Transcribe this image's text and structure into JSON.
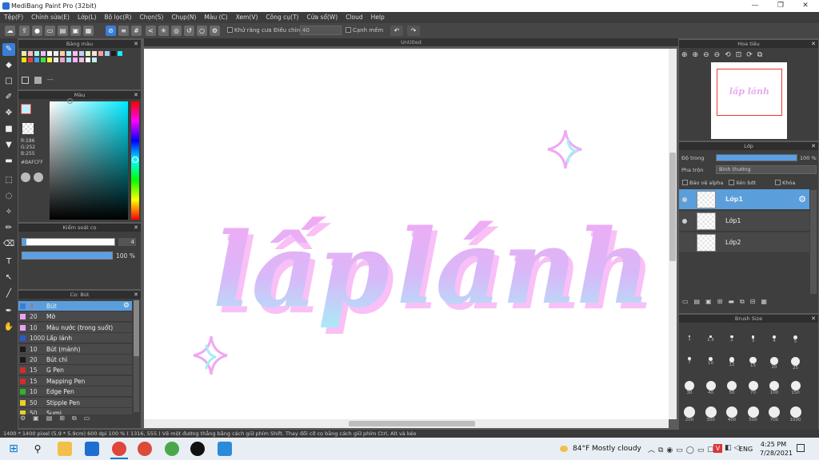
{
  "window": {
    "title": "MediBang Paint Pro (32bit)",
    "minimize": "—",
    "restore": "❐",
    "close": "✕"
  },
  "menu": [
    "Tệp(F)",
    "Chỉnh sửa(E)",
    "Lớp(L)",
    "Bộ lọc(R)",
    "Chọn(S)",
    "Chụp(N)",
    "Màu (C)",
    "Xem(V)",
    "Công cụ(T)",
    "Cửa sổ(W)",
    "Cloud",
    "Help"
  ],
  "toolbar": {
    "antialias_label": "Khử răng cưa",
    "adjust_label": "Điều chỉnh",
    "adjust_value": "40",
    "edge_label": "Cạnh mềm",
    "undo": "↶",
    "redo": "↷"
  },
  "palette_panel": {
    "title": "Bảng màu",
    "text": "---"
  },
  "color_panel": {
    "title": "Màu",
    "r": "R:186",
    "g": "G:252",
    "b": "B:255",
    "hex": "#BAFCFF"
  },
  "brush_control": {
    "title": "Kiểm soát cọ",
    "size": "4",
    "opacity": "100 %"
  },
  "brush_panel": {
    "title": "Cọ: Bút",
    "items": [
      {
        "size": "4",
        "name": "Bút",
        "color": "#3a7ed6",
        "text_color": "#e84a4a"
      },
      {
        "size": "20",
        "name": "Mờ",
        "color": "#e7a6f0"
      },
      {
        "size": "10",
        "name": "Màu nước (trong suốt)",
        "color": "#e7a6f0"
      },
      {
        "size": "1000",
        "name": "Lấp lánh",
        "color": "#2b57d6"
      },
      {
        "size": "10",
        "name": "Bút (mảnh)",
        "color": "#1a1a1a"
      },
      {
        "size": "20",
        "name": "Bút chì",
        "color": "#1a1a1a"
      },
      {
        "size": "15",
        "name": "G Pen",
        "color": "#d62b2b"
      },
      {
        "size": "15",
        "name": "Mapping Pen",
        "color": "#d62b2b"
      },
      {
        "size": "10",
        "name": "Edge Pen",
        "color": "#2bb62b"
      },
      {
        "size": "50",
        "name": "Stipple Pen",
        "color": "#e7d02b"
      },
      {
        "size": "50",
        "name": "Sumi",
        "color": "#e7d02b"
      }
    ]
  },
  "document": {
    "tab": "Untitled",
    "text_1": "lấp",
    "text_2": "lánh"
  },
  "navigator": {
    "title": "Hoa tiêu",
    "preview_text": "lấp lánh"
  },
  "layer_panel": {
    "title": "Lớp",
    "opacity_label": "Độ trong",
    "opacity_value": "100 %",
    "opacity_fraction": 1.0,
    "blend_label": "Pha trộn",
    "blend_value": "Bình thường",
    "protect_alpha": "Bảo vệ alpha",
    "clipping": "Xén bớt",
    "lock": "Khóa",
    "layers": [
      {
        "name": "Lớp1",
        "selected": true
      },
      {
        "name": "Lớp1",
        "selected": false
      },
      {
        "name": "Lớp2",
        "selected": false
      }
    ]
  },
  "brush_size_panel": {
    "title": "Brush Size",
    "row1": [
      ".",
      ".",
      ".",
      ".",
      ".",
      "."
    ],
    "row1b": [
      "1",
      "1.5",
      "2",
      "3",
      "4",
      "5"
    ],
    "row2": [
      "7",
      "10",
      "12",
      "15",
      "20",
      "25"
    ],
    "row3": [
      "30",
      "40",
      "50",
      "70",
      "100",
      "150"
    ],
    "row4": [
      "200",
      "300",
      "400",
      "500",
      "700",
      "1000"
    ]
  },
  "status": "1400 * 1400 pixel   (5.9 * 5.9cm)   600 dpi   100 %   ( 1316, 555 )   Vẽ một đường thẳng bằng cách giữ phím Shift. Thay đổi cỡ cọ bằng cách giữ phím Ctrl, Alt và kéo",
  "taskbar": {
    "weather": "84°F  Mostly cloudy",
    "lang": "ENG",
    "time": "4:25 PM",
    "date": "7/28/2021"
  },
  "colors": {
    "accent": "#5aa0e6",
    "selected_row": "#5a9fdc",
    "pink": "#f0a6f2",
    "cyan": "#a8ecf6"
  }
}
